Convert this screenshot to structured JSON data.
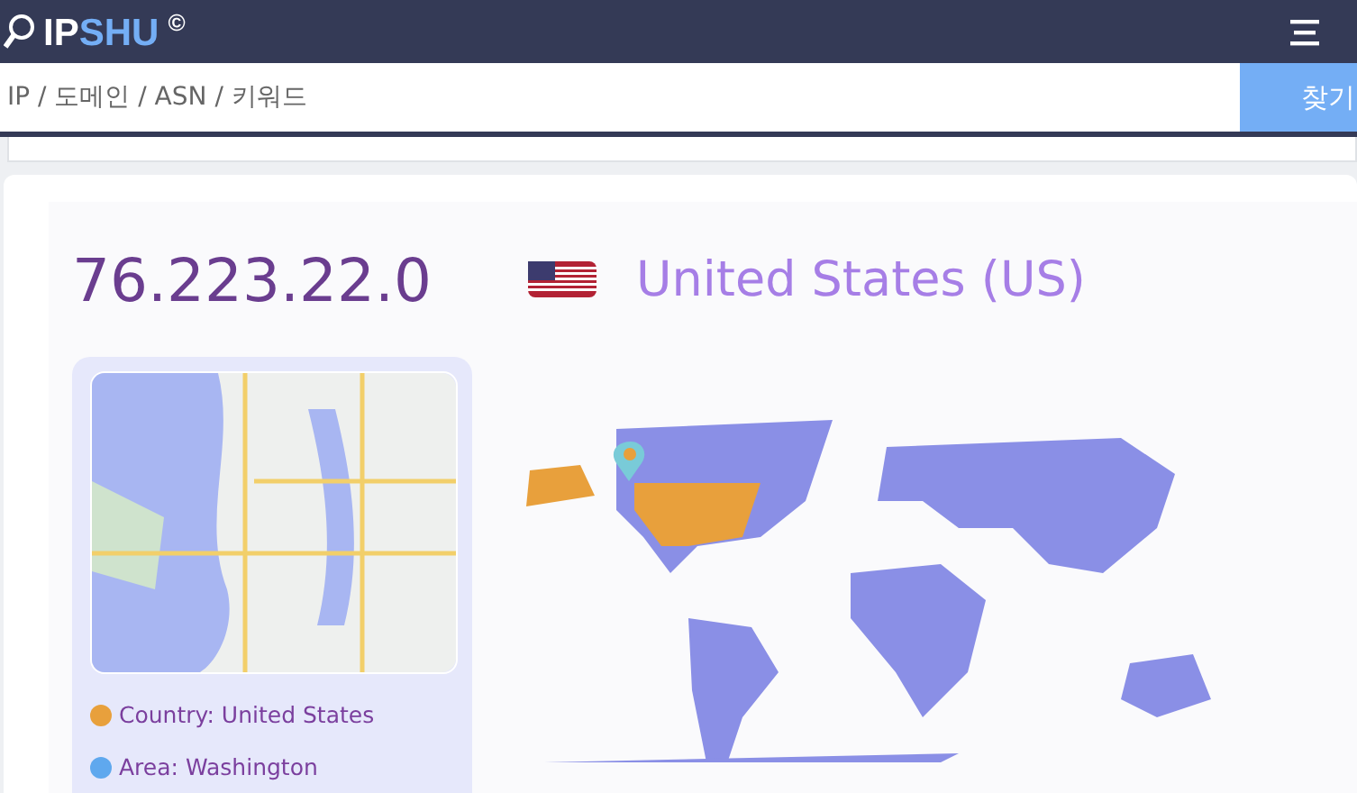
{
  "header": {
    "logo_first": "IP",
    "logo_second": "SHU",
    "logo_mark": "©"
  },
  "search": {
    "placeholder": "IP / 도메인 / ASN / 키워드",
    "button": "찾기"
  },
  "result": {
    "ip": "76.223.22.0",
    "country": "United States (US)"
  },
  "legend": [
    {
      "label": "Country: United States",
      "color": "#e8a03c"
    },
    {
      "label": "Area: Washington",
      "color": "#5fa8ee"
    }
  ]
}
